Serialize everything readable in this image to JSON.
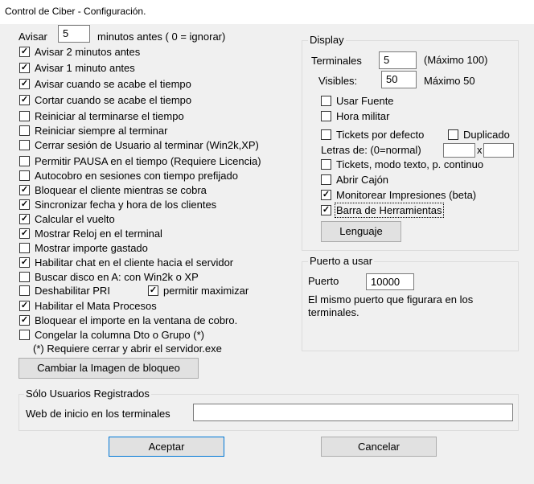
{
  "window": {
    "title": "Control de Ciber -  Configuración."
  },
  "avisar": {
    "label": "Avisar",
    "value": "5",
    "suffix": "minutos antes ( 0 = ignorar)"
  },
  "options": [
    {
      "label": "Avisar 2 minutos antes",
      "checked": true
    },
    {
      "label": "Avisar 1 minuto antes",
      "checked": true
    },
    {
      "label": "Avisar cuando se acabe el tiempo",
      "checked": true
    },
    {
      "label": "Cortar cuando se acabe el tiempo",
      "checked": true
    },
    {
      "label": "Reiniciar al terminarse el tiempo",
      "checked": false
    },
    {
      "label": "Reiniciar siempre al terminar",
      "checked": false
    },
    {
      "label": "Cerrar sesión de Usuario al terminar (Win2k,XP)",
      "checked": false
    },
    {
      "label": "Permitir PAUSA en el tiempo (Requiere Licencia)",
      "checked": false
    },
    {
      "label": "Autocobro en sesiones con tiempo prefijado",
      "checked": false
    },
    {
      "label": "Bloquear el cliente mientras se cobra",
      "checked": true
    },
    {
      "label": "Sincronizar fecha y hora de los clientes",
      "checked": true
    },
    {
      "label": "Calcular el vuelto",
      "checked": true
    },
    {
      "label": "Mostrar Reloj en el terminal",
      "checked": true
    },
    {
      "label": "Mostrar importe gastado",
      "checked": false
    },
    {
      "label": "Habilitar chat en el cliente hacia el servidor",
      "checked": true
    },
    {
      "label": "Buscar disco en A: con Win2k o XP",
      "checked": false
    },
    {
      "label": "Deshabilitar PRI",
      "checked": false
    },
    {
      "label": "Habilitar el Mata Procesos",
      "checked": true
    },
    {
      "label": "Bloquear el importe en la ventana de cobro.",
      "checked": true
    },
    {
      "label": "Congelar la columna Dto o Grupo (*)",
      "checked": false
    }
  ],
  "permitir_maximizar": {
    "label": "permitir maximizar",
    "checked": true
  },
  "note": "(*) Requiere cerrar y abrir el servidor.exe",
  "cambiar_imagen_label": "Cambiar la Imagen de bloqueo",
  "display": {
    "legend": "Display",
    "terminales_label": "Terminales",
    "terminales_value": "5",
    "terminales_hint": "(Máximo 100)",
    "visibles_label": "Visibles:",
    "visibles_value": "50",
    "visibles_hint": "Máximo 50",
    "usar_fuente": {
      "label": "Usar Fuente",
      "checked": false
    },
    "hora_militar": {
      "label": "Hora militar",
      "checked": false
    },
    "tickets_defecto": {
      "label": "Tickets por defecto",
      "checked": false
    },
    "duplicado": {
      "label": "Duplicado",
      "checked": false
    },
    "letras_label": "Letras de: (0=normal)",
    "letras_x": "x",
    "letras_w": "",
    "letras_h": "",
    "tickets_texto": {
      "label": "Tickets, modo texto, p. continuo",
      "checked": false
    },
    "abrir_cajon": {
      "label": "Abrir Cajón",
      "checked": false
    },
    "monitorear": {
      "label": "Monitorear Impresiones (beta)",
      "checked": true
    },
    "barra_herramientas": {
      "label": "Barra de Herramientas",
      "checked": true
    },
    "lenguaje_label": "Lenguaje"
  },
  "puerto": {
    "legend": "Puerto a usar",
    "label": "Puerto",
    "value": "10000",
    "note_line1": "El mismo puerto que figurara en los",
    "note_line2": "terminales."
  },
  "registrados": {
    "legend": "Sólo Usuarios Registrados",
    "web_label": "Web de inicio en los terminales",
    "web_value": ""
  },
  "aceptar_label": "Aceptar",
  "cancelar_label": "Cancelar"
}
